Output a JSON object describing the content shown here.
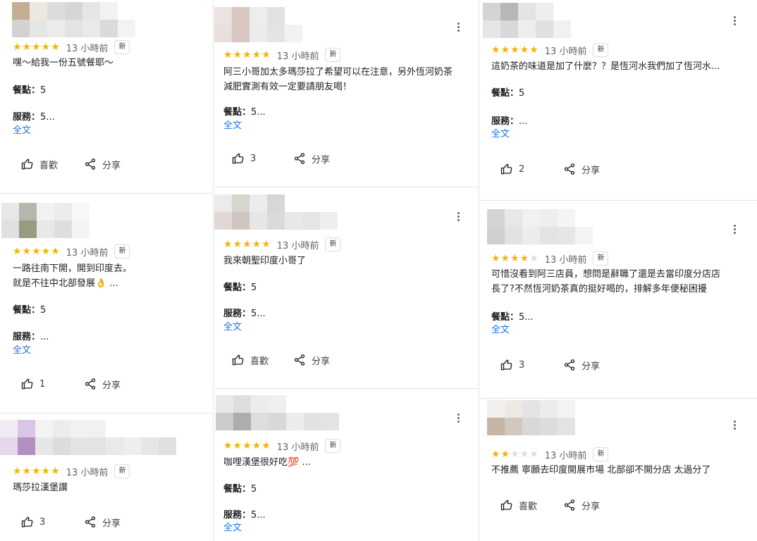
{
  "common": {
    "time": "13 小時前",
    "badge": "新",
    "full_text": "全文",
    "share": "分享",
    "like": "喜歡",
    "food_label": "餐點：",
    "service_label": "服務："
  },
  "reviews": [
    {
      "rating": 5,
      "line1": "嘿～給我一份五號餐耶～",
      "food": "5",
      "service": "5...",
      "likes": null
    },
    {
      "rating": 5,
      "line1": "一路往南下開，開到印度去。",
      "line2": "就是不往中北部發展👌 ...",
      "food": "5",
      "service": "...",
      "likes": "1"
    },
    {
      "rating": 5,
      "line1": "瑪莎拉漢堡讚",
      "likes": "3"
    },
    {
      "rating": 5,
      "line1": "阿三小哥加太多瑪莎拉了希望可以在注意，另外恆河奶茶",
      "line2": "減肥實測有效一定要請朋友喝！",
      "food": "5...",
      "likes": "3"
    },
    {
      "rating": 5,
      "line1": "我來朝聖印度小哥了",
      "food": "5",
      "service": "5...",
      "likes": null
    },
    {
      "rating": 5,
      "line1": "咖哩漢堡很好吃💯 ...",
      "food": "5",
      "service": "5..."
    },
    {
      "rating": 5,
      "line1": "這奶茶的味道是加了什麼？？是恆河水我們加了恆河水...",
      "food": "5",
      "service": "...",
      "likes": "2"
    },
    {
      "rating": 4,
      "line1": "可惜沒看到阿三店員，想問是辭職了還是去當印度分店店",
      "line2": "長了?不然恆河奶茶真的挺好喝的，排解多年便秘困擾",
      "food": "5...",
      "likes": "3"
    },
    {
      "rating": 2,
      "line1": "不推薦 寧願去印度開展市場 北部卻不開分店 太過分了",
      "likes": null
    }
  ]
}
